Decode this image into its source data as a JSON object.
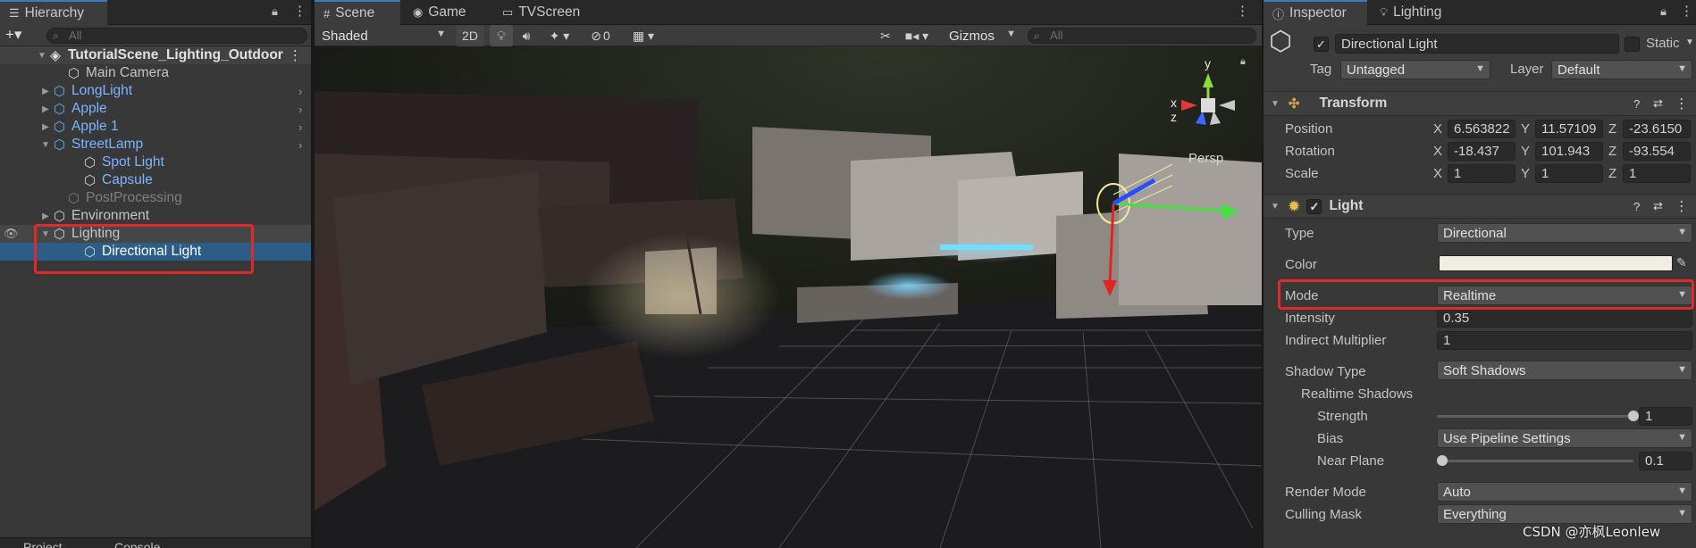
{
  "hierarchy": {
    "tab_label": "Hierarchy",
    "search_placeholder": "All",
    "add_label": "+▾",
    "scene_name": "TutorialScene_Lighting_Outdoor",
    "items": [
      {
        "label": "Main Camera",
        "style": "normal"
      },
      {
        "label": "LongLight",
        "style": "prefab"
      },
      {
        "label": "Apple",
        "style": "prefab"
      },
      {
        "label": "Apple 1",
        "style": "prefab"
      },
      {
        "label": "StreetLamp",
        "style": "prefab"
      },
      {
        "label": "Spot Light",
        "style": "prefab"
      },
      {
        "label": "Capsule",
        "style": "prefab"
      },
      {
        "label": "PostProcessing",
        "style": "disabled"
      },
      {
        "label": "Environment",
        "style": "normal"
      },
      {
        "label": "Lighting",
        "style": "normal"
      },
      {
        "label": "Directional Light",
        "style": "selected"
      }
    ],
    "bottom_tabs": [
      "Project",
      "Console"
    ]
  },
  "scene": {
    "tabs": [
      "Scene",
      "Game",
      "TVScreen"
    ],
    "shading_mode": "Shaded",
    "mode_2d": "2D",
    "hidden_count": "0",
    "gizmos_label": "Gizmos",
    "search_placeholder": "All",
    "persp_label": "Persp",
    "axis_labels": {
      "x": "x",
      "y": "y",
      "z": "z"
    }
  },
  "inspector": {
    "tabs": [
      "Inspector",
      "Lighting"
    ],
    "object_name": "Directional Light",
    "static_label": "Static",
    "tag_label": "Tag",
    "tag_value": "Untagged",
    "layer_label": "Layer",
    "layer_value": "Default",
    "transform": {
      "title": "Transform",
      "position": {
        "label": "Position",
        "x": "6.563822",
        "y": "11.57109",
        "z": "-23.6150"
      },
      "rotation": {
        "label": "Rotation",
        "x": "-18.437",
        "y": "101.943",
        "z": "-93.554"
      },
      "scale": {
        "label": "Scale",
        "x": "1",
        "y": "1",
        "z": "1"
      }
    },
    "light": {
      "title": "Light",
      "type_label": "Type",
      "type_value": "Directional",
      "color_label": "Color",
      "color_value": "#f1ede3",
      "mode_label": "Mode",
      "mode_value": "Realtime",
      "intensity_label": "Intensity",
      "intensity_value": "0.35",
      "indirect_label": "Indirect Multiplier",
      "indirect_value": "1",
      "shadow_type_label": "Shadow Type",
      "shadow_type_value": "Soft Shadows",
      "realtime_shadows_label": "Realtime Shadows",
      "strength_label": "Strength",
      "strength_value": "1",
      "strength_fraction": 1.0,
      "bias_label": "Bias",
      "bias_value": "Use Pipeline Settings",
      "near_plane_label": "Near Plane",
      "near_plane_value": "0.1",
      "near_plane_fraction": 0.0,
      "render_mode_label": "Render Mode",
      "render_mode_value": "Auto",
      "culling_mask_label": "Culling Mask",
      "culling_mask_value": "Everything"
    }
  },
  "watermark": "CSDN @亦枫Leonlew",
  "colors": {
    "accent": "#3a79bb",
    "selection": "#2c5d87",
    "highlight": "#e3282a",
    "prefab": "#7cb4ff"
  }
}
